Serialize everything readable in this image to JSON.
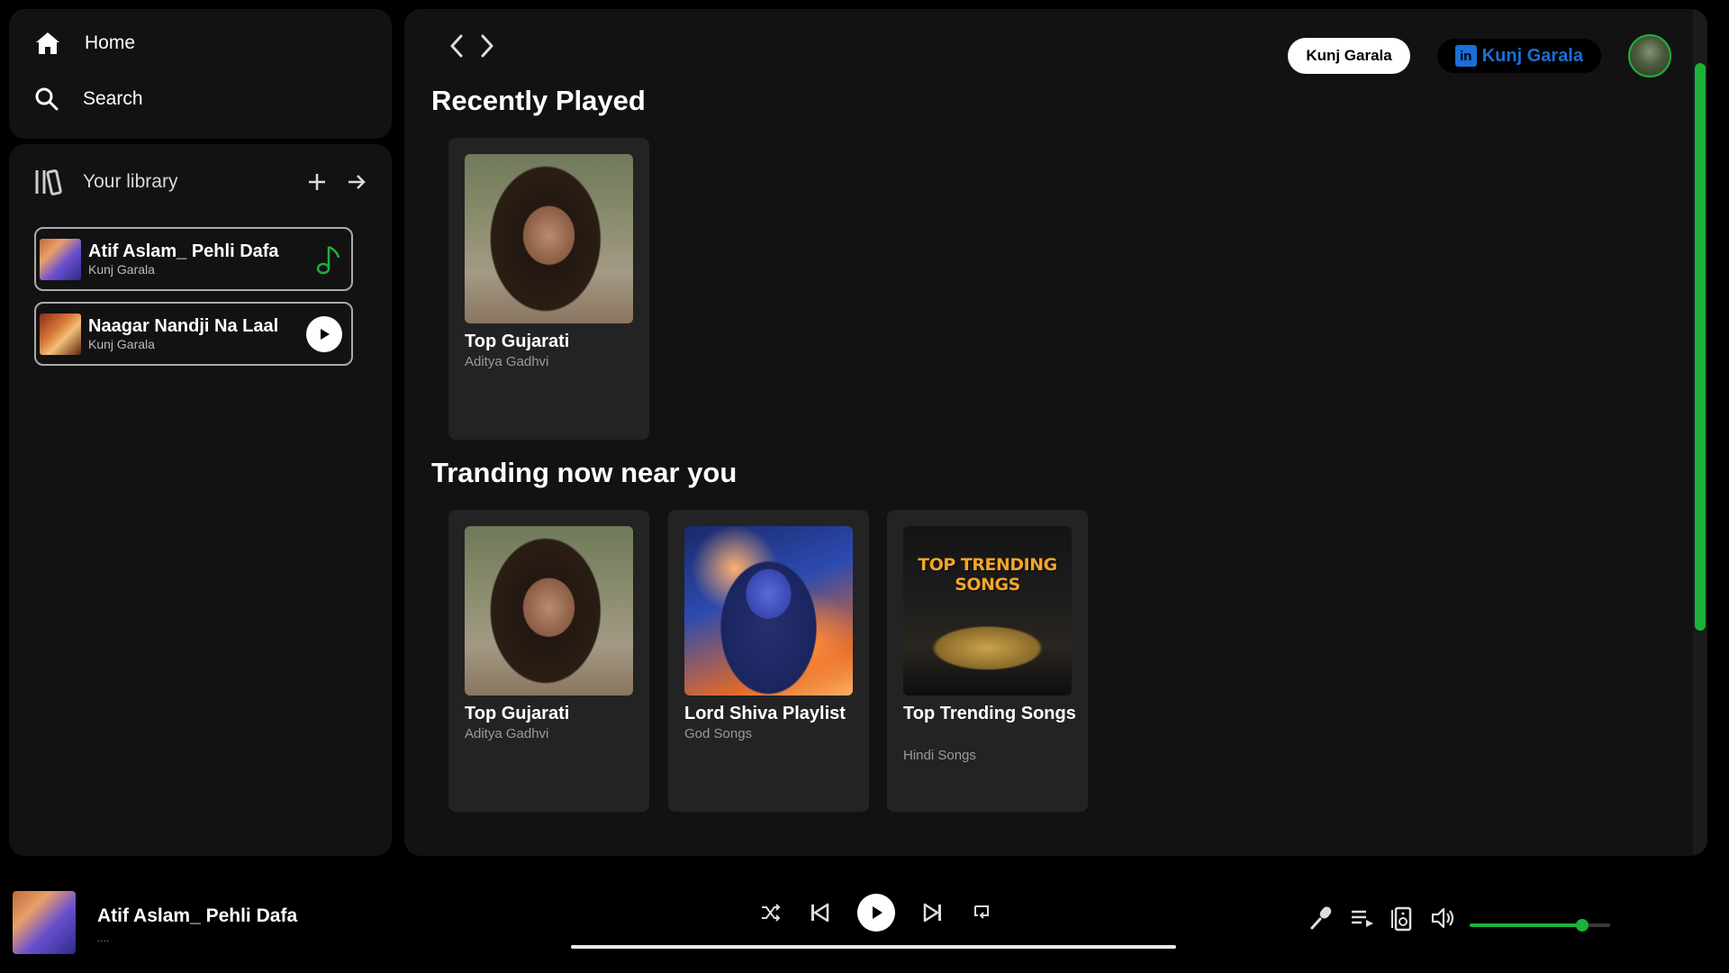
{
  "nav": {
    "home_label": "Home",
    "search_label": "Search"
  },
  "library": {
    "label": "Your library",
    "items": [
      {
        "title": "Atif Aslam_ Pehli Dafa",
        "subtitle": "Kunj Garala",
        "state": "playing"
      },
      {
        "title": "Naagar Nandji Na Laal",
        "subtitle": "Kunj Garala",
        "state": "paused"
      }
    ]
  },
  "header": {
    "user_button": "Kunj Garala",
    "linkedin_badge": "in",
    "linkedin_label": "Kunj Garala"
  },
  "recently_played": {
    "title": "Recently Played",
    "cards": [
      {
        "title": "Top Gujarati",
        "subtitle": "Aditya Gadhvi"
      }
    ]
  },
  "trending": {
    "title": "Tranding now near you",
    "cards": [
      {
        "title": "Top Gujarati",
        "subtitle": "Aditya Gadhvi"
      },
      {
        "title": "Lord Shiva Playlist",
        "subtitle": "God Songs"
      },
      {
        "title": "Top Trending Songs",
        "subtitle": "Hindi Songs",
        "art_text": "TOP TRENDING SONGS"
      }
    ]
  },
  "player": {
    "title": "Atif Aslam_ Pehli Dafa",
    "subtitle": "....",
    "progress": 1.0,
    "volume": 0.8
  },
  "colors": {
    "accent": "#1db13a",
    "linkedin": "#1a6fd6",
    "panel": "#121212",
    "card": "#232323"
  }
}
